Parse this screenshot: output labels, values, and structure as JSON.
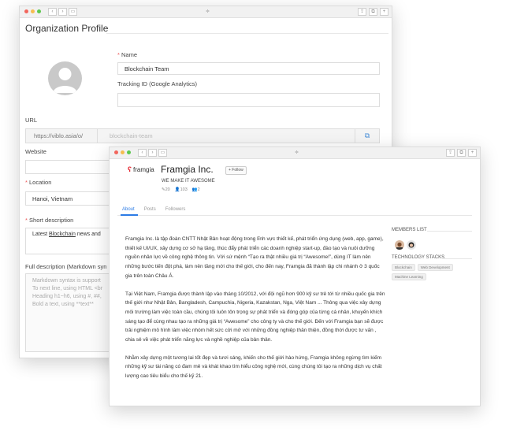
{
  "back_window": {
    "title": "Organization Profile",
    "url_bar": "≑",
    "name_label": "Name",
    "name_value": "Blockchain Team",
    "tracking_label": "Tracking ID (Google Analytics)",
    "tracking_value": "",
    "url_label": "URL",
    "url_prefix": "https://viblo.asia/o/",
    "url_value": "blockchain-team",
    "website_label": "Website",
    "location_label": "Location",
    "location_value": "Hanoi, Vietnam",
    "short_desc_label": "Short description",
    "short_desc_value_pre": "Latest ",
    "short_desc_value_link": "Blockchain",
    "short_desc_value_post": " news and",
    "full_desc_label": "Full description (Markdown syn",
    "md_lines": [
      "Markdown syntax is support",
      "To next line, using HTML <br",
      "Heading h1~h6, using #, ##,",
      "Bold a text, using **text**"
    ]
  },
  "front_window": {
    "url_bar": "≑",
    "logo_text": "framgia",
    "org_name": "Framgia Inc.",
    "follow_label": "+ Follow",
    "slogan": "WE MAKE IT AWESOME",
    "stats": {
      "posts": "20",
      "followers": "103",
      "members": "2"
    },
    "tabs": [
      "About",
      "Posts",
      "Followers"
    ],
    "active_tab": "About",
    "about": [
      "Framgia Inc. là tập đoàn CNTT Nhật Bản hoạt động trong lĩnh vực thiết kế, phát triển ứng dụng (web, app, game), thiết kế UI/UX, xây dựng cơ sở hạ tầng, thúc đẩy phát triển các doanh nghiệp start-up, đào tạo và nuôi dưỡng nguồn nhân lực về công nghệ thông tin. Với sứ mệnh “Tạo ra thật nhiều giá trị “Awesome!”, dùng IT làm nên những bước tiến đột phá, làm nên tầng mới cho thế giới, cho đến nay, Framgia đã thành lập chi nhánh ở 3 quốc gia trên toàn Châu Á.",
      "Tại Việt Nam, Framgia được thành lập vào tháng 10/2012, với đội ngũ hơn 900 kỹ sư trẻ tới từ nhiều quốc gia trên thế giới như Nhật Bản, Bangladesh, Campuchia, Nigeria, Kazakstan, Nga, Việt Nam ... Thông qua việc xây dựng môi trường làm việc toàn cầu, chúng tôi luôn tôn trọng sự phát triển và đóng góp của từng cá nhân, khuyến khích sáng tạo để cùng nhau tạo ra những giá trị “Awesome” cho công ty và cho thế giới. Đến với Framgia bạn sẽ được trải nghiệm mô hình làm việc nhóm hết sức cởi mở với những đồng nghiệp thân thiện, đồng thời được tư vấn , chia sẻ về việc phát triển năng lực và nghề nghiệp của bản thân.",
      "Nhằm xây dựng một tương lai tốt đẹp và tươi sáng, khiến cho thế giới hào hứng, Framgia không ngừng tìm kiếm những kỹ sư tài năng có đam mê và khát khao tìm hiểu công nghệ mới, cùng chúng tôi tạo ra những dịch vụ chất lượng cao tiêu biểu cho thế kỷ 21."
    ],
    "members_title": "MEMBERS LIST",
    "tech_title": "TECHNOLOGY STACKS",
    "tech_tags": [
      "Blockchain",
      "Web Development",
      "Machine Learning"
    ]
  },
  "colors": {
    "accent": "#2c7be5",
    "required": "#e55555",
    "brand_red": "#e5262f",
    "dot_red": "#f2665d",
    "dot_yellow": "#f6bd4f",
    "dot_green": "#5cc84e"
  }
}
